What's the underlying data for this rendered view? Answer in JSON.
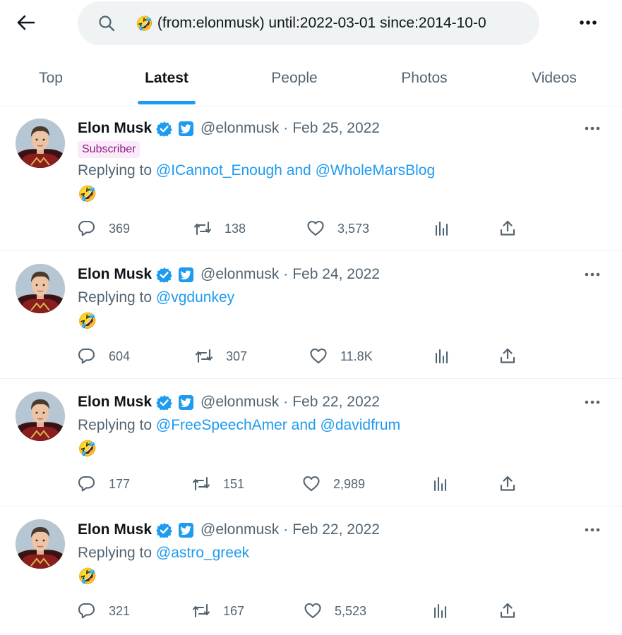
{
  "search": {
    "emoji": "🤣",
    "query": "(from:elonmusk) until:2022-03-01 since:2014-10-0"
  },
  "tabs": [
    {
      "label": "Top"
    },
    {
      "label": "Latest"
    },
    {
      "label": "People"
    },
    {
      "label": "Photos"
    },
    {
      "label": "Videos"
    }
  ],
  "active_tab": "Latest",
  "colors": {
    "accent": "#1d9bf0",
    "subscriber_bg": "#fbeaf9",
    "subscriber_text": "#8b1a87"
  },
  "tweets": [
    {
      "name": "Elon Musk",
      "handle": "@elonmusk",
      "sep": "·",
      "date": "Feb 25, 2022",
      "badge": "Subscriber",
      "replying_prefix": "Replying to",
      "mention1": "@ICannot_Enough",
      "conj": "and",
      "mention2": "@WholeMarsBlog",
      "emoji": "🤣",
      "replies": "369",
      "retweets": "138",
      "likes": "3,573"
    },
    {
      "name": "Elon Musk",
      "handle": "@elonmusk",
      "sep": "·",
      "date": "Feb 24, 2022",
      "replying_prefix": "Replying to",
      "mention1": "@vgdunkey",
      "emoji": "🤣",
      "replies": "604",
      "retweets": "307",
      "likes": "11.8K"
    },
    {
      "name": "Elon Musk",
      "handle": "@elonmusk",
      "sep": "·",
      "date": "Feb 22, 2022",
      "replying_prefix": "Replying to",
      "mention1": "@FreeSpeechAmer",
      "conj": "and",
      "mention2": "@davidfrum",
      "emoji": "🤣",
      "replies": "177",
      "retweets": "151",
      "likes": "2,989"
    },
    {
      "name": "Elon Musk",
      "handle": "@elonmusk",
      "sep": "·",
      "date": "Feb 22, 2022",
      "replying_prefix": "Replying to",
      "mention1": "@astro_greek",
      "emoji": "🤣",
      "replies": "321",
      "retweets": "167",
      "likes": "5,523"
    }
  ]
}
